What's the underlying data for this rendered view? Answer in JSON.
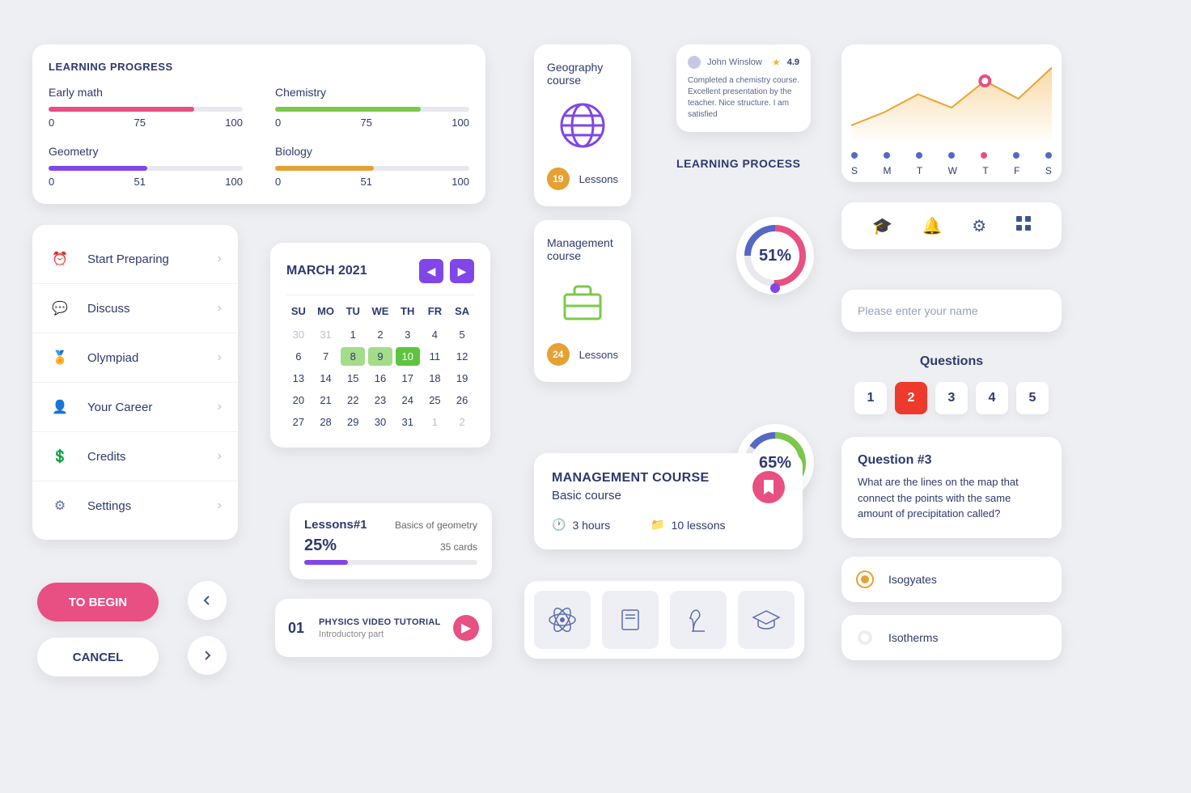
{
  "progress": {
    "title": "LEARNING PROGRESS",
    "items": [
      {
        "label": "Early math",
        "value": 75,
        "max": 100,
        "color": "#e84f82"
      },
      {
        "label": "Chemistry",
        "value": 75,
        "max": 100,
        "color": "#7cc84a"
      },
      {
        "label": "Geometry",
        "value": 51,
        "max": 100,
        "color": "#8046e8"
      },
      {
        "label": "Biology",
        "value": 51,
        "max": 100,
        "color": "#e5a134"
      }
    ]
  },
  "menu": [
    "Start Preparing",
    "Discuss",
    "Olympiad",
    "Your Career",
    "Credits",
    "Settings"
  ],
  "buttons": {
    "begin": "TO BEGIN",
    "cancel": "CANCEL"
  },
  "calendar": {
    "title": "MARCH 2021",
    "dow": [
      "SU",
      "MO",
      "TU",
      "WE",
      "TH",
      "FR",
      "SA"
    ],
    "selected": [
      8,
      9,
      10
    ]
  },
  "lesson": {
    "title": "Lessons#1",
    "subtitle": "Basics of geometry",
    "pct": "25%",
    "cards": "35 cards"
  },
  "video": {
    "num": "01",
    "title": "PHYSICS VIDEO TUTORIAL",
    "sub": "Introductory part"
  },
  "courses": [
    {
      "title": "Geography course",
      "lessons": "19",
      "label": "Lessons"
    },
    {
      "title": "Management course",
      "lessons": "24",
      "label": "Lessons"
    }
  ],
  "review": {
    "name": "John Winslow",
    "rating": "4.9",
    "text": "Completed a chemistry course. Excellent presentation by the teacher. Nice structure. I am satisfied"
  },
  "learning_process": {
    "title": "LEARNING PROCESS",
    "d1": "51%",
    "d2": "65%"
  },
  "mgmt": {
    "title": "MANAGEMENT COURSE",
    "sub": "Basic course",
    "hours": "3 hours",
    "lessons": "10 lessons"
  },
  "input": {
    "placeholder": "Please enter your name"
  },
  "questions": {
    "title": "Questions",
    "nums": [
      "1",
      "2",
      "3",
      "4",
      "5"
    ],
    "active": 1
  },
  "question_card": {
    "title": "Question #3",
    "text": "What are the lines on the map that connect the points with the same amount of precipitation called?"
  },
  "answers": [
    "Isogyates",
    "Isotherms"
  ],
  "chart_data": {
    "type": "area",
    "categories": [
      "S",
      "M",
      "T",
      "W",
      "T",
      "F",
      "S"
    ],
    "values": [
      20,
      35,
      55,
      40,
      70,
      50,
      85
    ],
    "highlight_index": 4,
    "title": "",
    "xlabel": "",
    "ylabel": "",
    "ylim": [
      0,
      100
    ]
  }
}
